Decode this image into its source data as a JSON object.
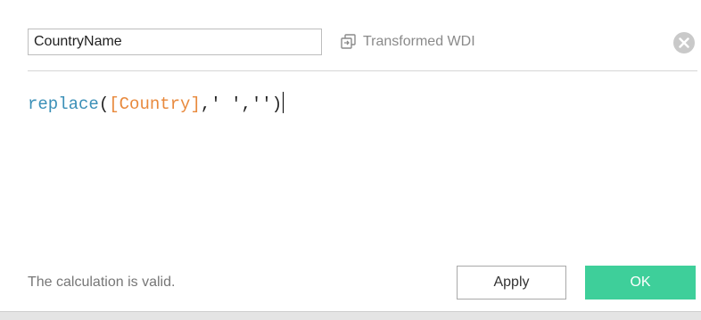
{
  "calc": {
    "name_value": "CountryName",
    "datasource_label": "Transformed WDI",
    "formula": {
      "fn": "replace",
      "open": "(",
      "field": "[Country]",
      "comma1": ",",
      "arg2": "' '",
      "comma2": ",",
      "arg3": "''",
      "close": ")"
    },
    "status": "The calculation is valid."
  },
  "buttons": {
    "apply": "Apply",
    "ok": "OK"
  },
  "colors": {
    "function": "#3a8fb7",
    "field": "#e8893c",
    "ok_bg": "#3ecf9a"
  },
  "icons": {
    "datasource": "datasource-icon",
    "close": "close-icon"
  }
}
